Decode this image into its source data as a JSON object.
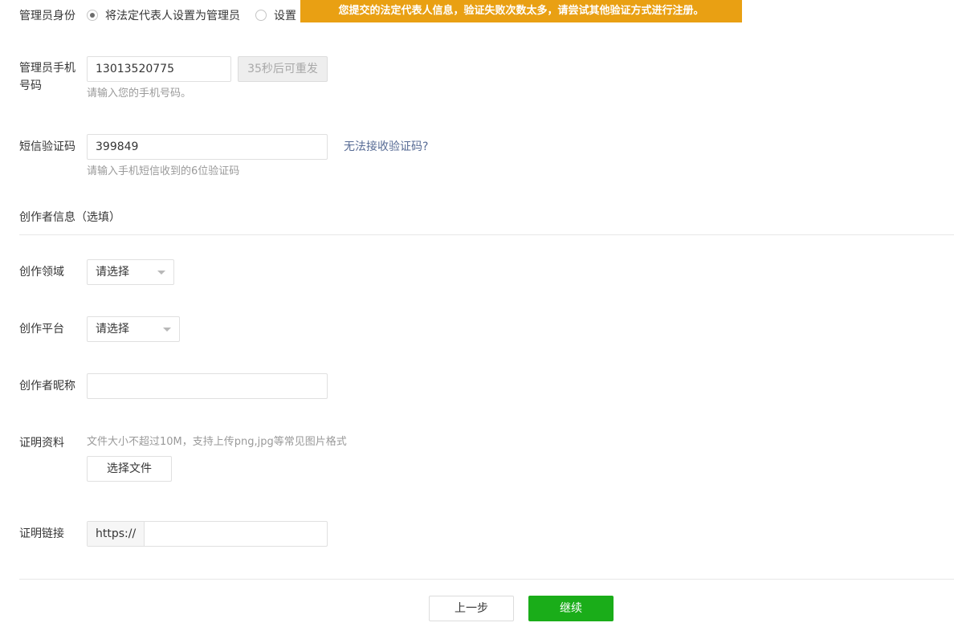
{
  "toast": {
    "message": "您提交的法定代表人信息，验证失败次数太多，请尝试其他验证方式进行注册。"
  },
  "admin_identity": {
    "label": "管理员身份",
    "options": [
      {
        "label": "将法定代表人设置为管理员",
        "checked": true
      },
      {
        "label": "设置",
        "checked": false
      }
    ]
  },
  "phone": {
    "label_line1": "管理员手机",
    "label_line2": "号码",
    "value": "13013520775",
    "resend_label": "35秒后可重发",
    "hint": "请输入您的手机号码。"
  },
  "sms_code": {
    "label": "短信验证码",
    "value": "399849",
    "help_link": "无法接收验证码?",
    "hint": "请输入手机短信收到的6位验证码"
  },
  "creator_section": {
    "title": "创作者信息（选填）"
  },
  "creation_field": {
    "label": "创作领域",
    "selected": "请选择"
  },
  "creation_platform": {
    "label": "创作平台",
    "selected": "请选择"
  },
  "creator_nickname": {
    "label": "创作者昵称",
    "value": ""
  },
  "proof_material": {
    "label": "证明资料",
    "hint": "文件大小不超过10M，支持上传png,jpg等常见图片格式",
    "button_label": "选择文件"
  },
  "proof_link": {
    "label": "证明链接",
    "prefix": "https://",
    "value": ""
  },
  "footer": {
    "back_label": "上一步",
    "continue_label": "继续"
  },
  "colors": {
    "toast": "#e9a013",
    "primary": "#1aad19",
    "link": "#576b95"
  }
}
